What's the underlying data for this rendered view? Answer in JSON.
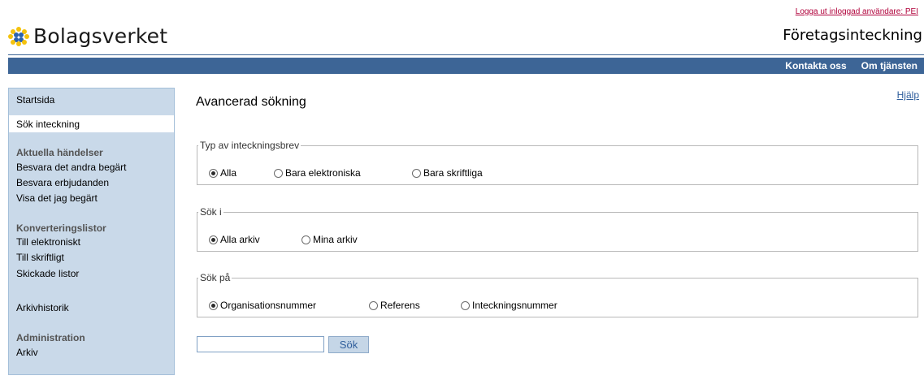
{
  "header": {
    "logout_link": "Logga ut inloggad användare: PEI",
    "logo_text": "Bolagsverket",
    "app_title": "Företagsinteckning"
  },
  "topnav": {
    "contact": "Kontakta oss",
    "about": "Om tjänsten"
  },
  "sidebar": {
    "start": "Startsida",
    "search": "Sök inteckning",
    "events_heading": "Aktuella händelser",
    "events": [
      "Besvara det andra begärt",
      "Besvara erbjudanden",
      "Visa det jag begärt"
    ],
    "conversion_heading": "Konverteringslistor",
    "conversion": [
      "Till elektroniskt",
      "Till skriftligt",
      "Skickade listor"
    ],
    "archive_history": "Arkivhistorik",
    "admin_heading": "Administration",
    "admin": [
      "Arkiv"
    ]
  },
  "main": {
    "title": "Avancerad sökning",
    "help": "Hjälp",
    "groups": [
      {
        "legend": "Typ av inteckningsbrev",
        "options": [
          {
            "label": "Alla",
            "checked": true
          },
          {
            "label": "Bara elektroniska",
            "checked": false
          },
          {
            "label": "Bara skriftliga",
            "checked": false
          }
        ]
      },
      {
        "legend": "Sök i",
        "options": [
          {
            "label": "Alla arkiv",
            "checked": true
          },
          {
            "label": "Mina arkiv",
            "checked": false
          }
        ]
      },
      {
        "legend": "Sök på",
        "options": [
          {
            "label": "Organisationsnummer",
            "checked": true
          },
          {
            "label": "Referens",
            "checked": false
          },
          {
            "label": "Inteckningsnummer",
            "checked": false
          }
        ]
      }
    ],
    "search_value": "",
    "search_button": "Sök"
  },
  "colors": {
    "brand_blue": "#3d6596",
    "sidebar_bg": "#c9d9e9",
    "logout_red": "#b0003a",
    "logo_yellow": "#f4c20d",
    "logo_blue": "#2a63b0"
  }
}
